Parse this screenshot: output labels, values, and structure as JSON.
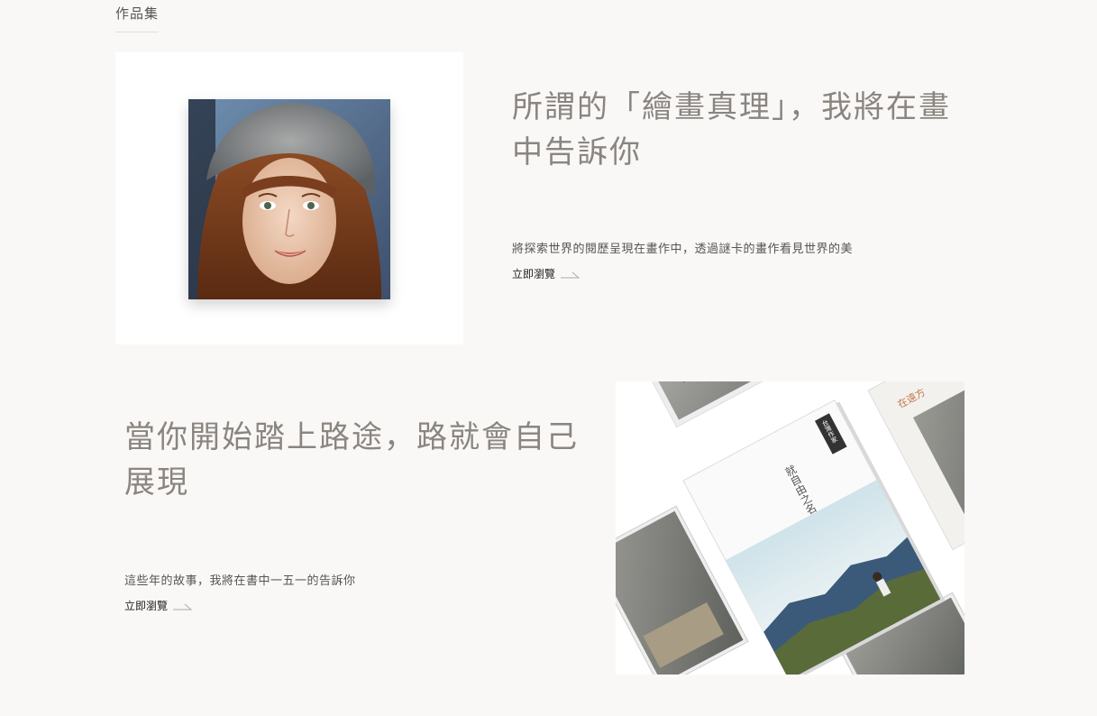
{
  "section": {
    "heading": "作品集"
  },
  "works": [
    {
      "title_line1": "所謂的「繪畫真理」，我將在畫",
      "title_line2": "中告訴你",
      "description": "將探索世界的閱歷呈現在畫作中，透過謎卡的畫作看見世界的美",
      "link_label": "立即瀏覽",
      "image": "painted-portrait-of-girl-with-grey-hat"
    },
    {
      "title_line1": "當你開始踏上路途，路就會自己",
      "title_line2": "展現",
      "description": "這些年的故事，我將在書中一五一的告訴你",
      "link_label": "立即瀏覽",
      "image": "book-covers-collage",
      "book_cover_text": {
        "title": "就自由之名",
        "badge": "台灣作家",
        "top_right": "在遠方"
      }
    }
  ],
  "colors": {
    "background": "#faf8f6",
    "title": "#8a8580",
    "body_text": "#555555",
    "link": "#222222"
  }
}
